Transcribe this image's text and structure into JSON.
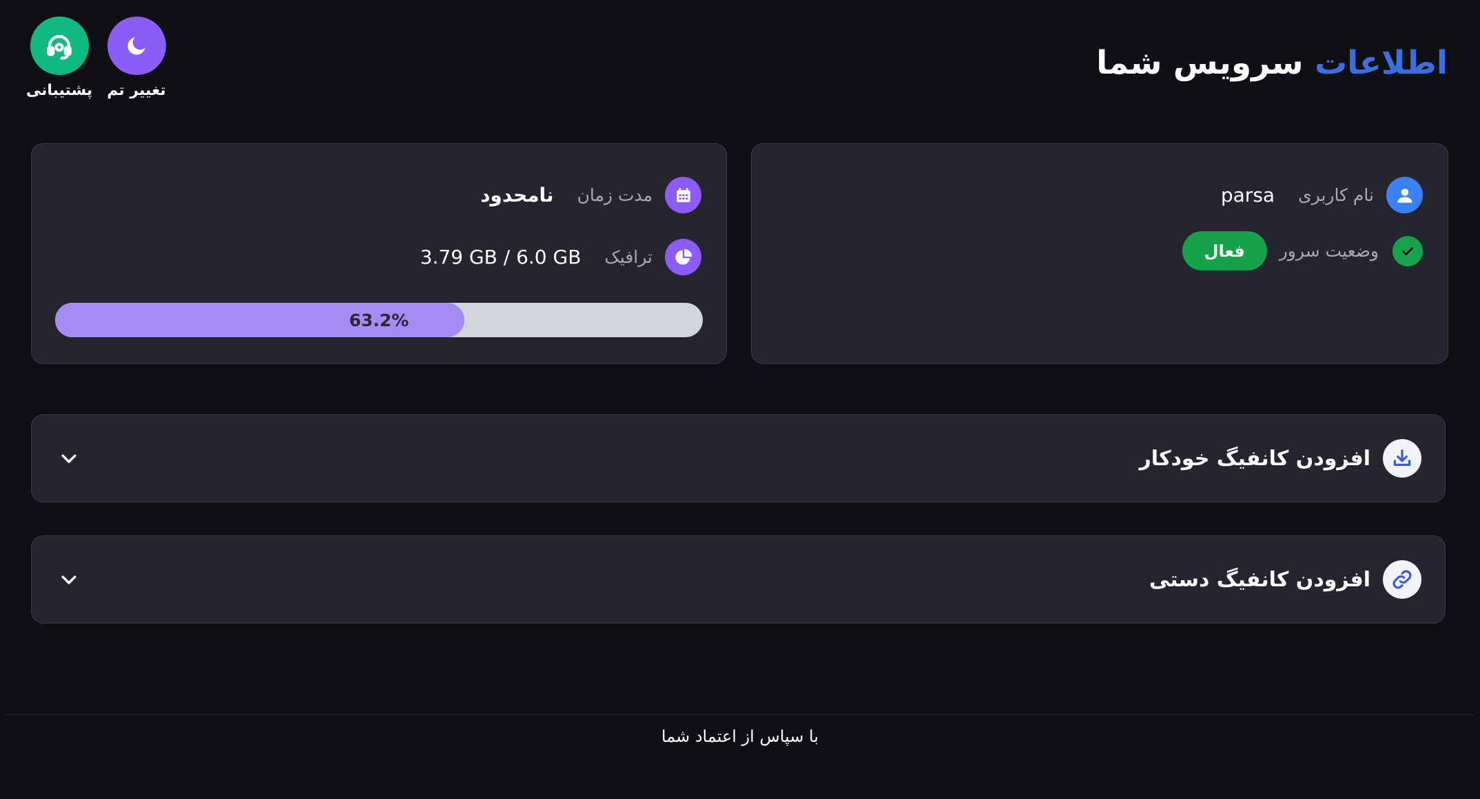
{
  "header": {
    "title_accent": "اطلاعات",
    "title_rest": "سرویس شما"
  },
  "top_actions": {
    "theme_label": "تغییر تم",
    "support_label": "پشتیبانی"
  },
  "user_card": {
    "username_label": "نام کاربری",
    "username_value": "parsa",
    "status_label": "وضعیت سرور",
    "status_value": "فعال"
  },
  "usage_card": {
    "duration_label": "مدت زمان",
    "duration_value": "نامحدود",
    "traffic_label": "ترافیک",
    "traffic_value": "3.79 GB / 6.0 GB",
    "progress_fraction": 0.632,
    "progress_text": "63.2%"
  },
  "accordions": [
    {
      "title": "افزودن کانفیگ خودکار",
      "icon": "download-icon"
    },
    {
      "title": "افزودن کانفیگ دستی",
      "icon": "link-icon"
    }
  ],
  "footer": {
    "text": "با سپاس از اعتماد شما"
  },
  "colors": {
    "background": "#0f1014",
    "card": "#24252f",
    "accent_blue": "#3b6fe0",
    "purple": "#8b5cf6",
    "green": "#10b981",
    "status_green": "#15a249",
    "progress_fill": "#a58cf5"
  }
}
